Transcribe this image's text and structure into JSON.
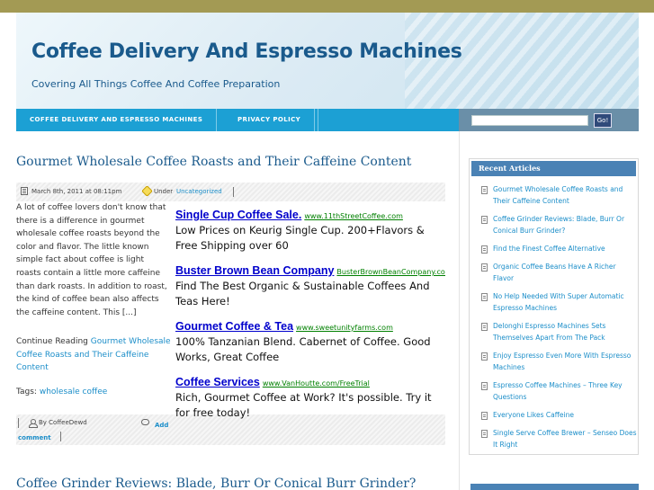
{
  "site": {
    "title": "Coffee Delivery And Espresso Machines",
    "description": "Covering All Things Coffee And Coffee Preparation"
  },
  "nav": {
    "items": [
      "Coffee Delivery And Espresso Machines",
      "Privacy Policy"
    ],
    "search_button": "Go!"
  },
  "post": {
    "title": "Gourmet Wholesale Coffee Roasts and Their Caffeine Content",
    "date": "March 8th, 2011 at 08:11pm",
    "under_label": "Under",
    "category": "Uncategorized",
    "excerpt": "A lot of coffee lovers don't know that there is a difference in gourmet wholesale coffee roasts beyond the color and flavor. The little known simple fact about coffee is light roasts contain a little more caffeine than dark roasts. In addition to roast, the kind of coffee bean also affects the caffeine content. This [...]",
    "continue_prefix": "Continue Reading",
    "continue_link": "Gourmet Wholesale Coffee Roasts and Their Caffeine Content",
    "tags_label": "Tags:",
    "tag": "wholesale coffee",
    "author": "By CoffeeDewd",
    "comment_link": "Add comment"
  },
  "ads": [
    {
      "title": "Single Cup Coffee Sale.",
      "url": "www.11thStreetCoffee.com",
      "body": "Low Prices on Keurig Single Cup. 200+Flavors & Free Shipping over 60"
    },
    {
      "title": "Buster Brown Bean Company",
      "url": "BusterBrownBeanCompany.com",
      "body": "Find The Best Organic & Sustainable Coffees And Teas Here!"
    },
    {
      "title": "Gourmet Coffee & Tea",
      "url": "www.sweetunityfarms.com",
      "body": "100% Tanzanian Blend. Cabernet of Coffee. Good Works, Great Coffee"
    },
    {
      "title": "Coffee Services",
      "url": "www.VanHoutte.com/FreeTrial",
      "body": "Rich, Gourmet Coffee at Work? It's possible. Try it for free today!"
    }
  ],
  "next_post": {
    "title": "Coffee Grinder Reviews: Blade, Burr Or Conical Burr Grinder?"
  },
  "sidebar": {
    "heading": "Recent Articles",
    "items": [
      "Gourmet Wholesale Coffee Roasts and Their Caffeine Content",
      "Coffee Grinder Reviews: Blade, Burr Or Conical Burr Grinder?",
      "Find the Finest Coffee Alternative",
      "Organic Coffee Beans Have A Richer Flavor",
      "No Help Needed With Super Automatic Espresso Machines",
      "Delonghi Espresso Machines Sets Themselves Apart From The Pack",
      "Enjoy Espresso Even More With Espresso Machines",
      "Espresso Coffee Machines – Three Key Questions",
      "Everyone Likes Caffeine",
      "Single Serve Coffee Brewer – Senseo Does It Right"
    ]
  }
}
